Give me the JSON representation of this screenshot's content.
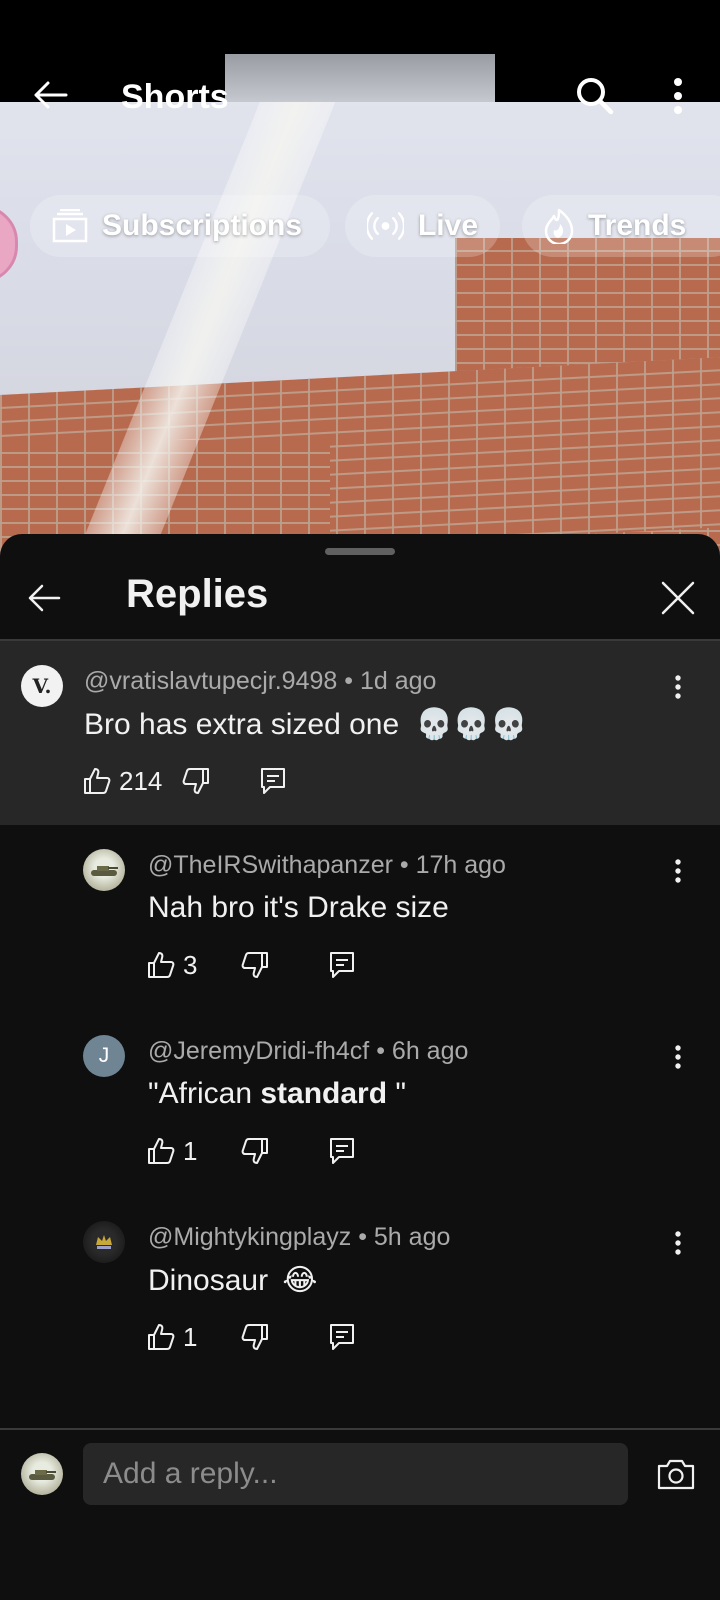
{
  "top_bar": {
    "title": "Shorts"
  },
  "chips": [
    {
      "label": "Subscriptions",
      "icon": "subscriptions-icon"
    },
    {
      "label": "Live",
      "icon": "live-icon"
    },
    {
      "label": "Trends",
      "icon": "trends-icon"
    }
  ],
  "sheet": {
    "title": "Replies",
    "parent_comment": {
      "author": "@vratislavtupecjr.9498",
      "time": "1d ago",
      "text": "Bro has extra sized one",
      "emoji": "💀💀💀",
      "likes": "214",
      "avatar_letter": "V."
    },
    "replies": [
      {
        "author": "@TheIRSwithapanzer",
        "time": "17h ago",
        "text": "Nah bro it's Drake size",
        "likes": "3"
      },
      {
        "author": "@JeremyDridi-fh4cf",
        "time": "6h ago",
        "text_plain": "\"African ",
        "text_bold": "standard",
        "text_end": " \"",
        "likes": "1",
        "avatar_letter": "J"
      },
      {
        "author": "@Mightykingplayz",
        "time": "5h ago",
        "text": "Dinosaur",
        "emoji": "😂",
        "likes": "1"
      }
    ]
  },
  "input": {
    "placeholder": "Add a reply..."
  },
  "colors": {
    "sheet_bg": "#0f0f0f",
    "parent_bg": "#272727",
    "meta_text": "#aaaaaa",
    "text": "#f1f1f1"
  }
}
